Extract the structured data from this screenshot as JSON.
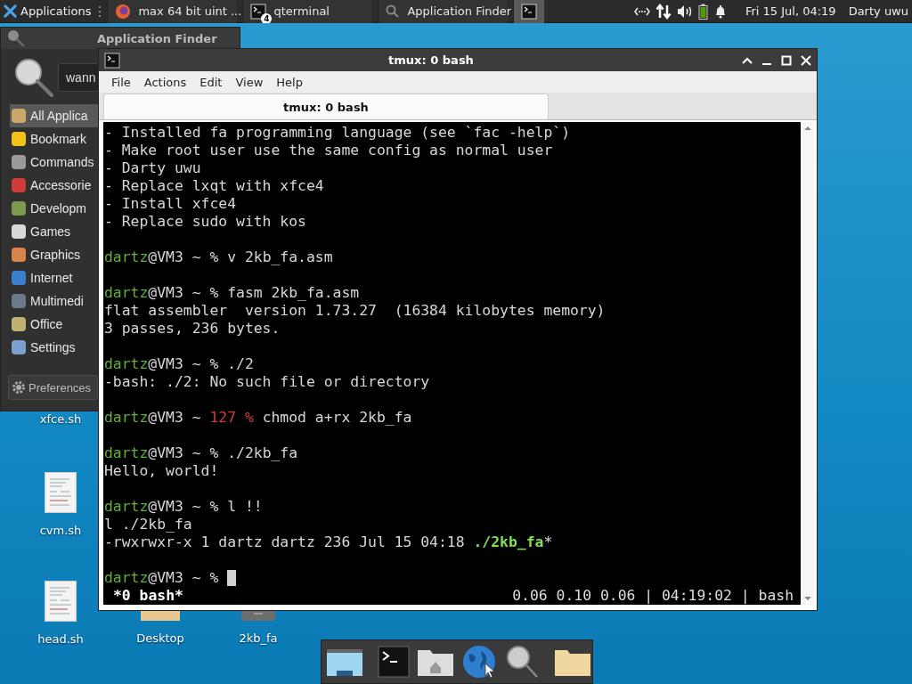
{
  "top_panel": {
    "applications_label": "Applications",
    "tasks": [
      {
        "label": "max 64 bit uint ...",
        "kind": "browser",
        "selected": false
      },
      {
        "label": "qterminal",
        "kind": "terminal",
        "badge": "4",
        "selected": false
      },
      {
        "label": "Application Finder",
        "kind": "search",
        "selected": false
      },
      {
        "kind": "terminal",
        "selected": true
      }
    ],
    "clock": "Fri 15 Jul, 04:19",
    "user": "Darty uwu"
  },
  "app_finder": {
    "title": "Application Finder",
    "search_value": "wann",
    "categories": [
      {
        "label": "All Applica",
        "selected": true
      },
      {
        "label": "Bookmark",
        "selected": false
      },
      {
        "label": "Commands",
        "selected": false
      },
      {
        "label": "Accessorie",
        "selected": false
      },
      {
        "label": "Developm",
        "selected": false
      },
      {
        "label": "Games",
        "selected": false
      },
      {
        "label": "Graphics",
        "selected": false
      },
      {
        "label": "Internet",
        "selected": false
      },
      {
        "label": "Multimedi",
        "selected": false
      },
      {
        "label": "Office",
        "selected": false
      },
      {
        "label": "Settings",
        "selected": false
      }
    ],
    "preferences_label": "Preferences"
  },
  "desktop_icons": [
    {
      "label": "xfce.sh",
      "kind": "label_only"
    },
    {
      "label": "cvm.sh",
      "kind": "document"
    },
    {
      "label": "head.sh",
      "kind": "document"
    },
    {
      "label": "Desktop",
      "kind": "folder"
    },
    {
      "label": "2kb_fa",
      "kind": "executable"
    }
  ],
  "terminal": {
    "title": "tmux: 0 bash",
    "menu": [
      "File",
      "Actions",
      "Edit",
      "View",
      "Help"
    ],
    "tabs": [
      {
        "label": "tmux: 0 bash",
        "selected": true
      }
    ],
    "lines": [
      {
        "kind": "text",
        "text": "- Installed fa programming language (see `fac -help`)"
      },
      {
        "kind": "text",
        "text": "- Make root user use the same config as normal user"
      },
      {
        "kind": "text",
        "text": "- Darty uwu"
      },
      {
        "kind": "text",
        "text": "- Replace lxqt with xfce4"
      },
      {
        "kind": "text",
        "text": "- Install xfce4"
      },
      {
        "kind": "text",
        "text": "- Replace sudo with kos"
      },
      {
        "kind": "blank"
      },
      {
        "kind": "prompt",
        "user": "dartz",
        "host": "@VM3",
        "path": "~",
        "sign": "%",
        "command": "v 2kb_fa.asm"
      },
      {
        "kind": "blank"
      },
      {
        "kind": "prompt",
        "user": "dartz",
        "host": "@VM3",
        "path": "~",
        "sign": "%",
        "command": "fasm 2kb_fa.asm"
      },
      {
        "kind": "text",
        "text": "flat assembler  version 1.73.27  (16384 kilobytes memory)"
      },
      {
        "kind": "text",
        "text": "3 passes, 236 bytes."
      },
      {
        "kind": "blank"
      },
      {
        "kind": "prompt",
        "user": "dartz",
        "host": "@VM3",
        "path": "~",
        "sign": "%",
        "command": "./2"
      },
      {
        "kind": "text",
        "text": "-bash: ./2: No such file or directory"
      },
      {
        "kind": "blank"
      },
      {
        "kind": "prompt",
        "user": "dartz",
        "host": "@VM3",
        "path": "~",
        "status": "127",
        "sign": "%",
        "command": "chmod a+rx 2kb_fa"
      },
      {
        "kind": "blank"
      },
      {
        "kind": "prompt",
        "user": "dartz",
        "host": "@VM3",
        "path": "~",
        "sign": "%",
        "command": "./2kb_fa"
      },
      {
        "kind": "text",
        "text": "Hello, world!"
      },
      {
        "kind": "blank"
      },
      {
        "kind": "prompt",
        "user": "dartz",
        "host": "@VM3",
        "path": "~",
        "sign": "%",
        "command": "l !!"
      },
      {
        "kind": "text",
        "text": "l ./2kb_fa"
      },
      {
        "kind": "listing",
        "text": "-rwxrwxr-x 1 dartz dartz 236 Jul 15 04:18 ",
        "file": "./2kb_fa",
        "suffix": "*"
      },
      {
        "kind": "blank"
      },
      {
        "kind": "prompt",
        "user": "dartz",
        "host": "@VM3",
        "path": "~",
        "sign": "%",
        "cursor": true
      }
    ],
    "status_left": "*0 bash*",
    "status_right": "0.06 0.10 0.06 | 04:19:02 | bash"
  }
}
